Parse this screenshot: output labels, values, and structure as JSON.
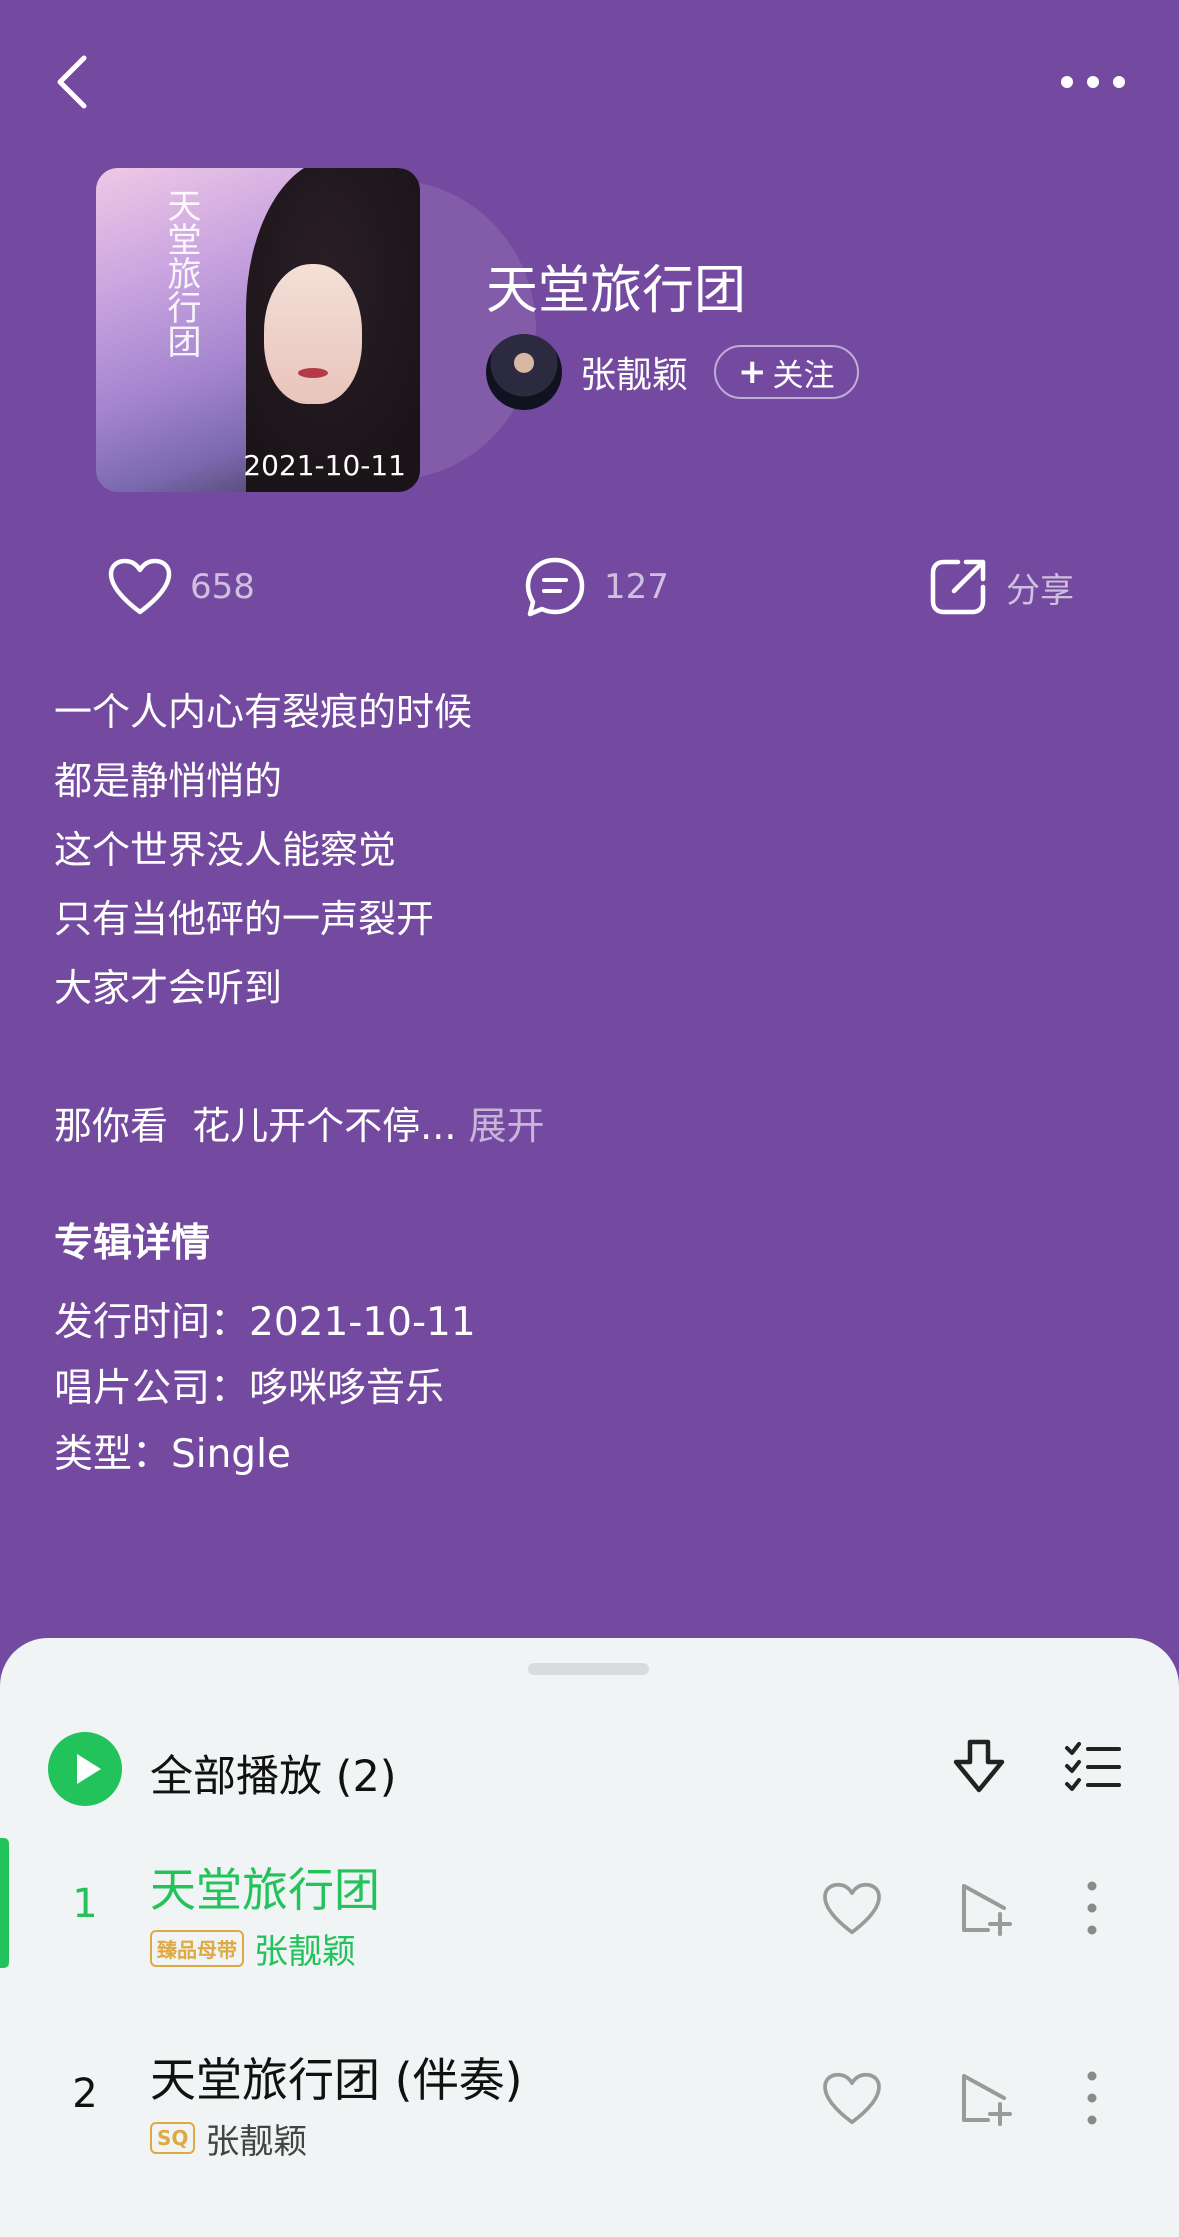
{
  "album": {
    "title": "天堂旅行团",
    "cover_date": "2021-10-11",
    "cover_art_text": "天堂旅行团",
    "artist": "张靓颖",
    "follow_label": "关注",
    "follow_icon": "plus-icon"
  },
  "stats": {
    "likes": "658",
    "comments": "127",
    "share_label": "分享"
  },
  "description": {
    "lines": [
      "一个人内心有裂痕的时候",
      "都是静悄悄的",
      "这个世界没人能察觉",
      "只有当他砰的一声裂开",
      "大家才会听到"
    ],
    "last_line": "那你看  花儿开个不停...",
    "expand_label": "展开"
  },
  "details": {
    "title": "专辑详情",
    "release": "发行时间：2021-10-11",
    "label": "唱片公司：哆咪哆音乐",
    "type": "类型：Single"
  },
  "playlist": {
    "play_all_label": "全部播放 (2)",
    "tracks": [
      {
        "num": "1",
        "title": "天堂旅行团",
        "badge": "臻品母带",
        "artist": "张靓颖",
        "active": true
      },
      {
        "num": "2",
        "title": "天堂旅行团 (伴奏)",
        "badge": "SQ",
        "artist": "张靓颖",
        "active": false
      }
    ]
  },
  "colors": {
    "background": "#744aa0",
    "accent_green": "#22c35a",
    "badge_gold": "#e0a842",
    "sheet": "#f0f4f4"
  },
  "icons": [
    "back-icon",
    "more-icon",
    "heart-icon",
    "comment-icon",
    "share-icon",
    "play-icon",
    "download-icon",
    "multiselect-icon",
    "add-to-playlist-icon",
    "more-vertical-icon"
  ]
}
